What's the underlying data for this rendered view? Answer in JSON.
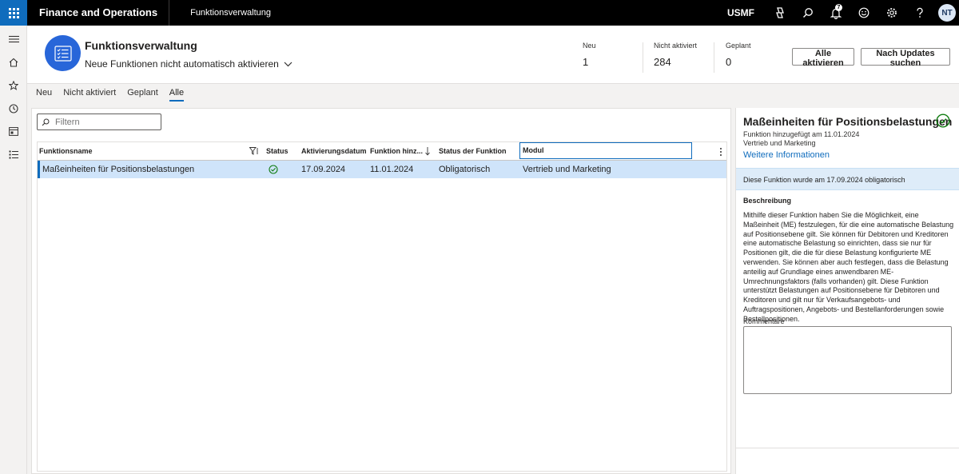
{
  "topbar": {
    "app_title": "Finance and Operations",
    "module_title": "Funktionsverwaltung",
    "company": "USMF",
    "notification_count": "7",
    "user_initials": "NT"
  },
  "header": {
    "title": "Funktionsverwaltung",
    "subtitle": "Neue Funktionen nicht automatisch aktivieren",
    "stats": [
      {
        "label": "Neu",
        "value": "1"
      },
      {
        "label": "Nicht aktiviert",
        "value": "284"
      },
      {
        "label": "Geplant",
        "value": "0"
      }
    ],
    "buttons": {
      "activate_all": "Alle aktivieren",
      "check_updates": "Nach Updates suchen"
    }
  },
  "tabs": [
    "Neu",
    "Nicht aktiviert",
    "Geplant",
    "Alle"
  ],
  "active_tab": "Alle",
  "filter": {
    "placeholder": "Filtern"
  },
  "grid": {
    "columns": [
      "Funktionsname",
      "Status",
      "Aktivierungsdatum",
      "Funktion hinz...",
      "Status der Funktion",
      "Modul"
    ],
    "rows": [
      {
        "name": "Maßeinheiten für Positionsbelastungen",
        "status": "enabled",
        "activation_date": "17.09.2024",
        "added_date": "11.01.2024",
        "feature_status": "Obligatorisch",
        "module": "Vertrieb und Marketing"
      }
    ]
  },
  "details": {
    "title": "Maßeinheiten für Positionsbelastungen",
    "added": "Funktion hinzugefügt am 11.01.2024",
    "module": "Vertrieb und Marketing",
    "link": "Weitere Informationen",
    "banner": "Diese Funktion wurde am 17.09.2024 obligatorisch",
    "description_heading": "Beschreibung",
    "description": "Mithilfe dieser Funktion haben Sie die Möglichkeit, eine Maßeinheit (ME) festzulegen, für die eine automatische Belastung auf Positionsebene gilt. Sie können für Debitoren und Kreditoren eine automatische Belastung so einrichten, dass sie nur für Positionen gilt, die die für diese Belastung konfigurierte ME verwenden. Sie können aber auch festlegen, dass die Belastung anteilig auf Grundlage eines anwendbaren ME-Umrechnungsfaktors (falls vorhanden) gilt. Diese Funktion unterstützt Belastungen auf Positionsebene für Debitoren und Kreditoren und gilt nur für Verkaufsangebots- und Auftragspositionen, Angebots- und Bestellanforderungen sowie Bestellpositionen.",
    "comments_label": "Kommentare"
  },
  "colors": {
    "accent": "#0f6cbd",
    "header_icon": "#2866d9",
    "selected_row": "#cfe4fa",
    "success": "#107c10"
  }
}
